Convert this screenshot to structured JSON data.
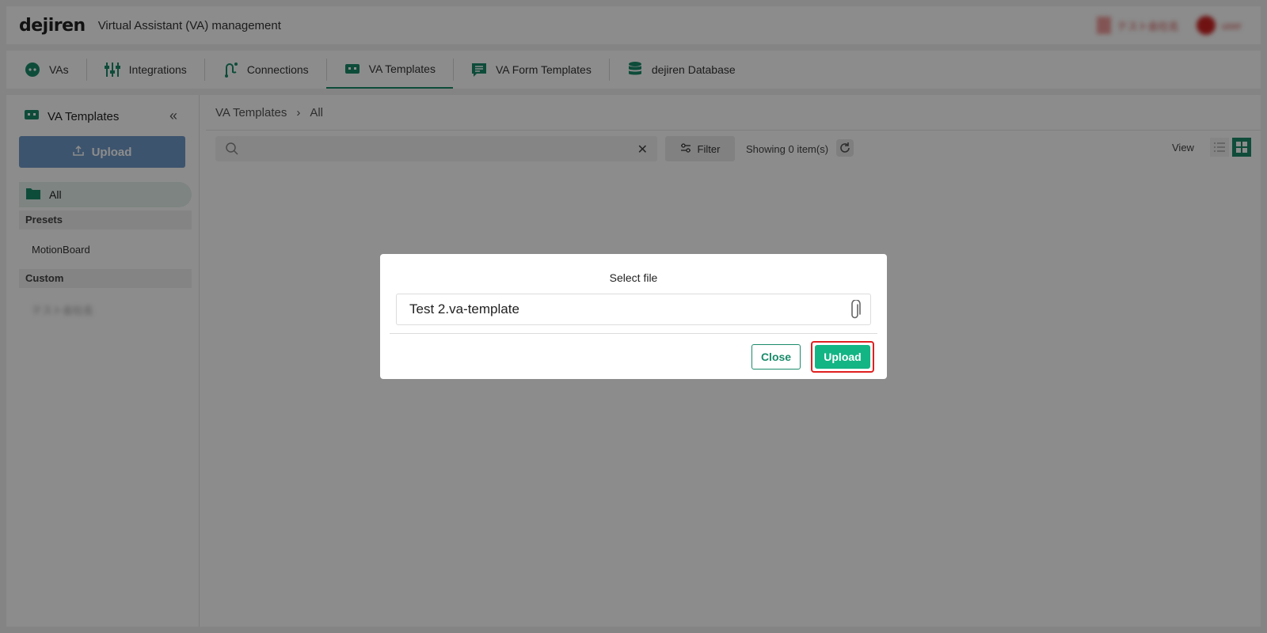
{
  "header": {
    "logo": "dejiren",
    "app_title": "Virtual Assistant (VA) management",
    "account_label": "テスト会社名",
    "user_label": "user"
  },
  "nav": {
    "tabs": [
      {
        "label": "VAs",
        "icon": "robot-face-icon",
        "active": false
      },
      {
        "label": "Integrations",
        "icon": "sliders-icon",
        "active": false
      },
      {
        "label": "Connections",
        "icon": "connection-icon",
        "active": false
      },
      {
        "label": "VA Templates",
        "icon": "va-template-icon",
        "active": true
      },
      {
        "label": "VA Form Templates",
        "icon": "form-icon",
        "active": false
      },
      {
        "label": "dejiren Database",
        "icon": "database-icon",
        "active": false
      }
    ]
  },
  "sidebar": {
    "title": "VA Templates",
    "upload_label": "Upload",
    "all_label": "All",
    "presets_label": "Presets",
    "preset_items": [
      "MotionBoard"
    ],
    "custom_label": "Custom",
    "custom_items": [
      "テスト会社名"
    ]
  },
  "breadcrumb": {
    "root": "VA Templates",
    "separator": "›",
    "current": "All"
  },
  "toolbar": {
    "search_placeholder": "",
    "filter_label": "Filter",
    "showing_text": "Showing 0 item(s)",
    "view_label": "View"
  },
  "modal": {
    "title": "Select file",
    "file_name": "Test 2.va-template",
    "close_label": "Close",
    "upload_label": "Upload"
  },
  "colors": {
    "accent": "#1a8b6a",
    "upload_button": "#13b584",
    "highlight_border": "#e02020",
    "sidebar_upload": "#6f9ac8"
  }
}
